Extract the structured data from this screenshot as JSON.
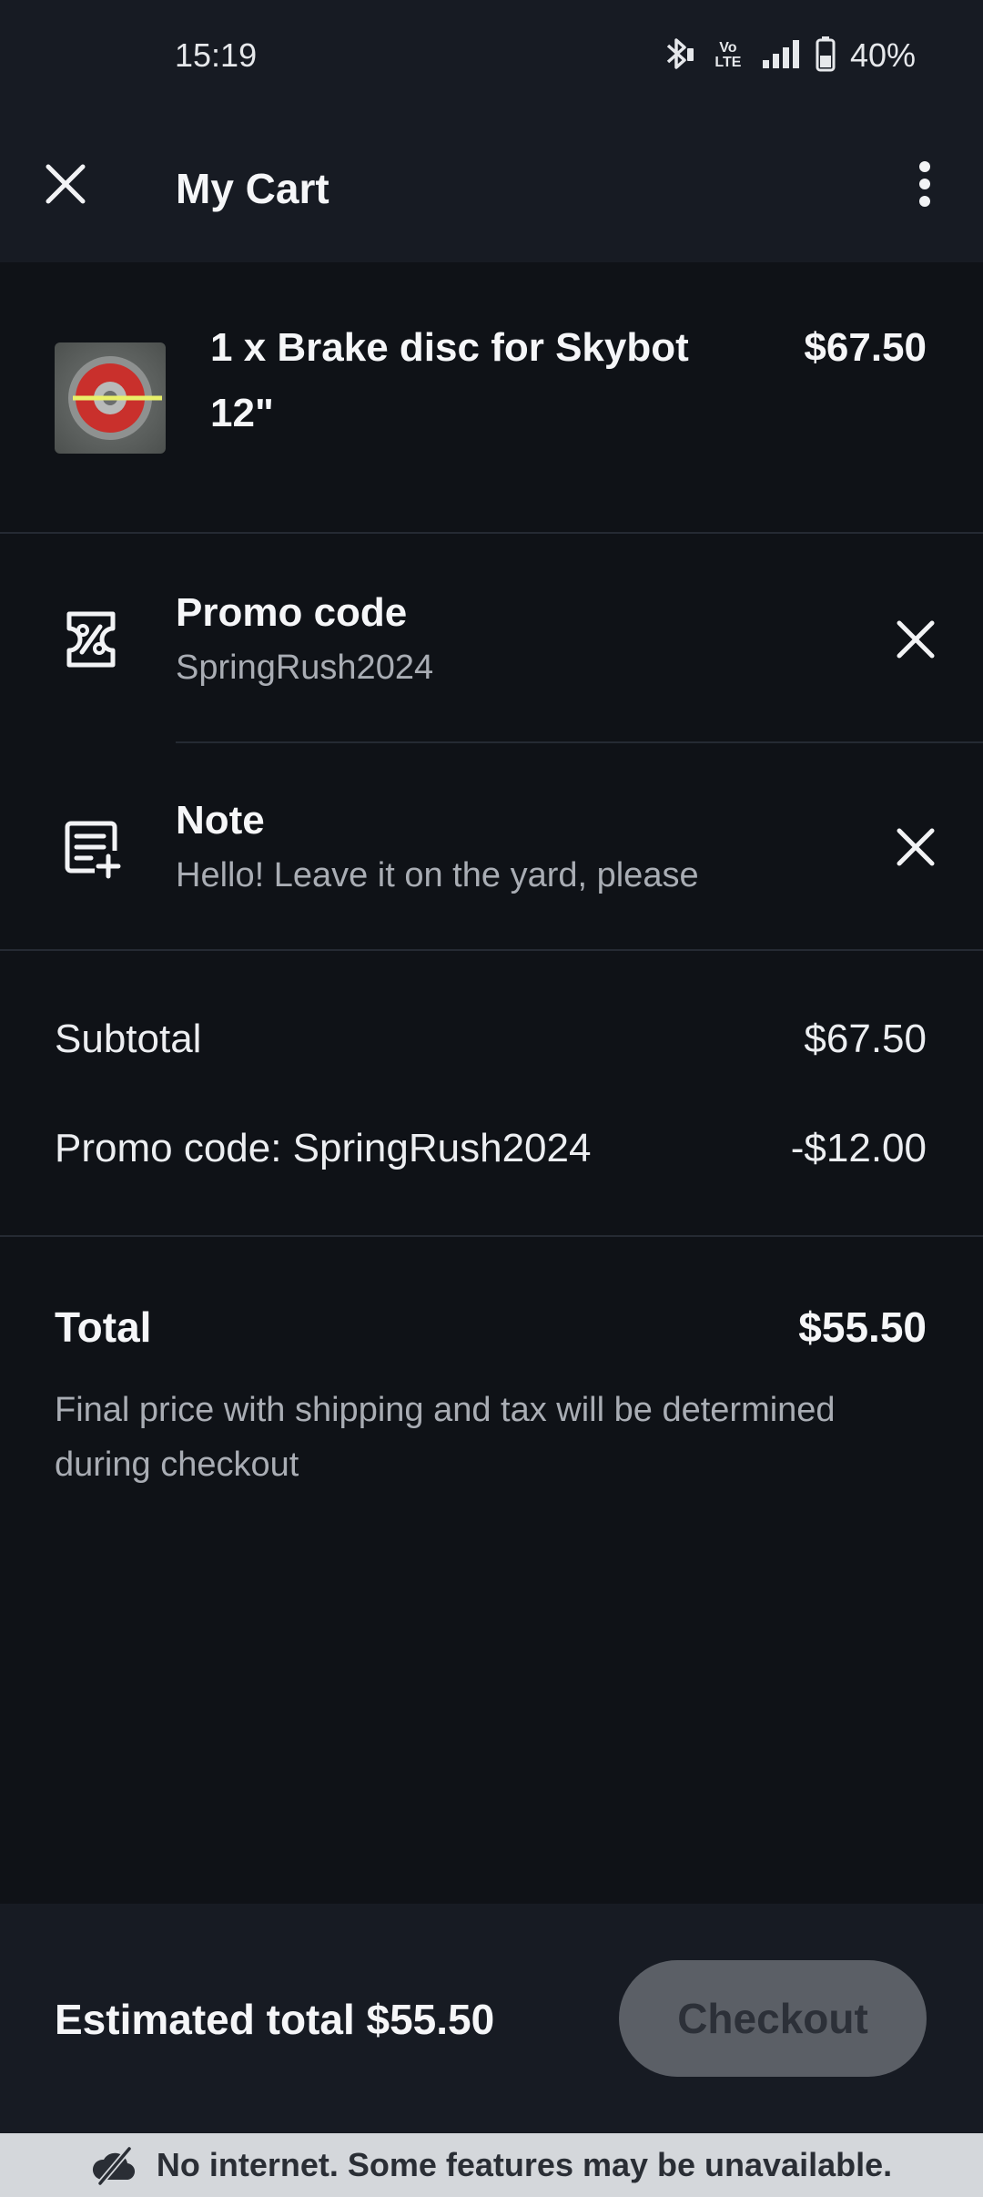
{
  "status_bar": {
    "time": "15:19",
    "battery": "40%",
    "volte_label": "Vo LTE",
    "icons": [
      "bluetooth-icon",
      "volte-icon",
      "signal-icon",
      "battery-icon"
    ]
  },
  "app_bar": {
    "title": "My Cart",
    "close_icon": "close-icon",
    "more_icon": "more-vert-icon"
  },
  "cart": {
    "items": [
      {
        "title": "1 x Brake disc for Skybot 12\"",
        "price": "$67.50",
        "thumbnail_icon": "brake-disc-image"
      }
    ]
  },
  "promo": {
    "title": "Promo code",
    "value": "SpringRush2024",
    "icon": "discount-ticket-icon"
  },
  "note": {
    "title": "Note",
    "value": "Hello! Leave it on the yard, please",
    "icon": "note-add-icon"
  },
  "summary": {
    "subtotal_label": "Subtotal",
    "subtotal_value": "$67.50",
    "promo_label": "Promo code: SpringRush2024",
    "promo_value": "-$12.00",
    "total_label": "Total",
    "total_value": "$55.50",
    "disclaimer": "Final price with shipping and tax will be determined during checkout"
  },
  "footer": {
    "estimated_total": "Estimated total $55.50",
    "checkout_label": "Checkout"
  },
  "offline_banner": {
    "text": "No internet. Some features may be unavailable.",
    "icon": "cloud-off-icon"
  },
  "colors": {
    "background": "#0f1217",
    "surface": "#171b23",
    "text_primary": "#f5f6f8",
    "text_secondary": "#a9adb4",
    "checkout_disabled": "#5b5f66",
    "banner": "#d4d7db"
  }
}
